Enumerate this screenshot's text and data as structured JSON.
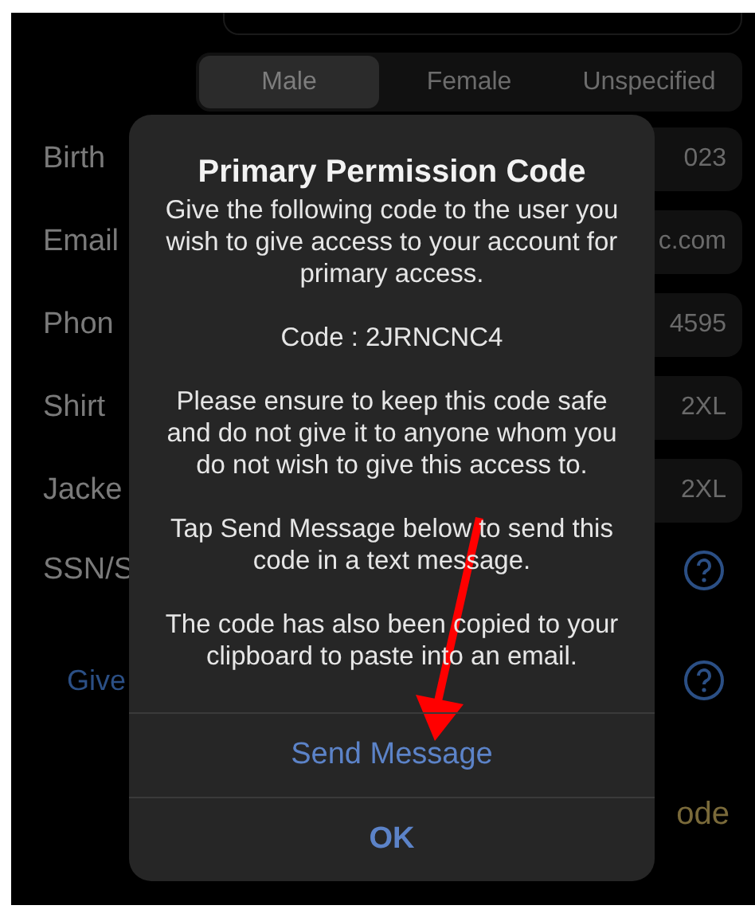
{
  "gender_selector": [
    {
      "label": "Male",
      "selected": true
    },
    {
      "label": "Female",
      "selected": false
    },
    {
      "label": "Unspecified",
      "selected": false
    }
  ],
  "rows": [
    {
      "kind": "field",
      "label": "Birth",
      "value": "023"
    },
    {
      "kind": "field",
      "label": "Email",
      "value": "c.com"
    },
    {
      "kind": "field",
      "label": "Phon",
      "value": "4595"
    },
    {
      "kind": "field",
      "label": "Shirt",
      "value": "2XL"
    },
    {
      "kind": "field",
      "label": "Jacke",
      "value": "2XL"
    },
    {
      "kind": "help",
      "label": "SSN/S"
    },
    {
      "kind": "link",
      "label": "Give"
    },
    {
      "kind": "code",
      "value": "ode"
    }
  ],
  "dialog": {
    "title": "Primary Permission Code",
    "paragraphs": [
      "Give the following code to the user you wish to give access to your account for primary access.",
      "Code : 2JRNCNC4",
      "Please ensure to keep this code safe and do not give it to anyone whom you do not wish to give this access to.",
      "Tap Send Message below to send this code in a text message.",
      "The code has also been copied to your clipboard to paste into an email."
    ],
    "buttons": [
      {
        "label": "Send Message",
        "kind": "normal"
      },
      {
        "label": "OK",
        "kind": "default"
      }
    ]
  }
}
